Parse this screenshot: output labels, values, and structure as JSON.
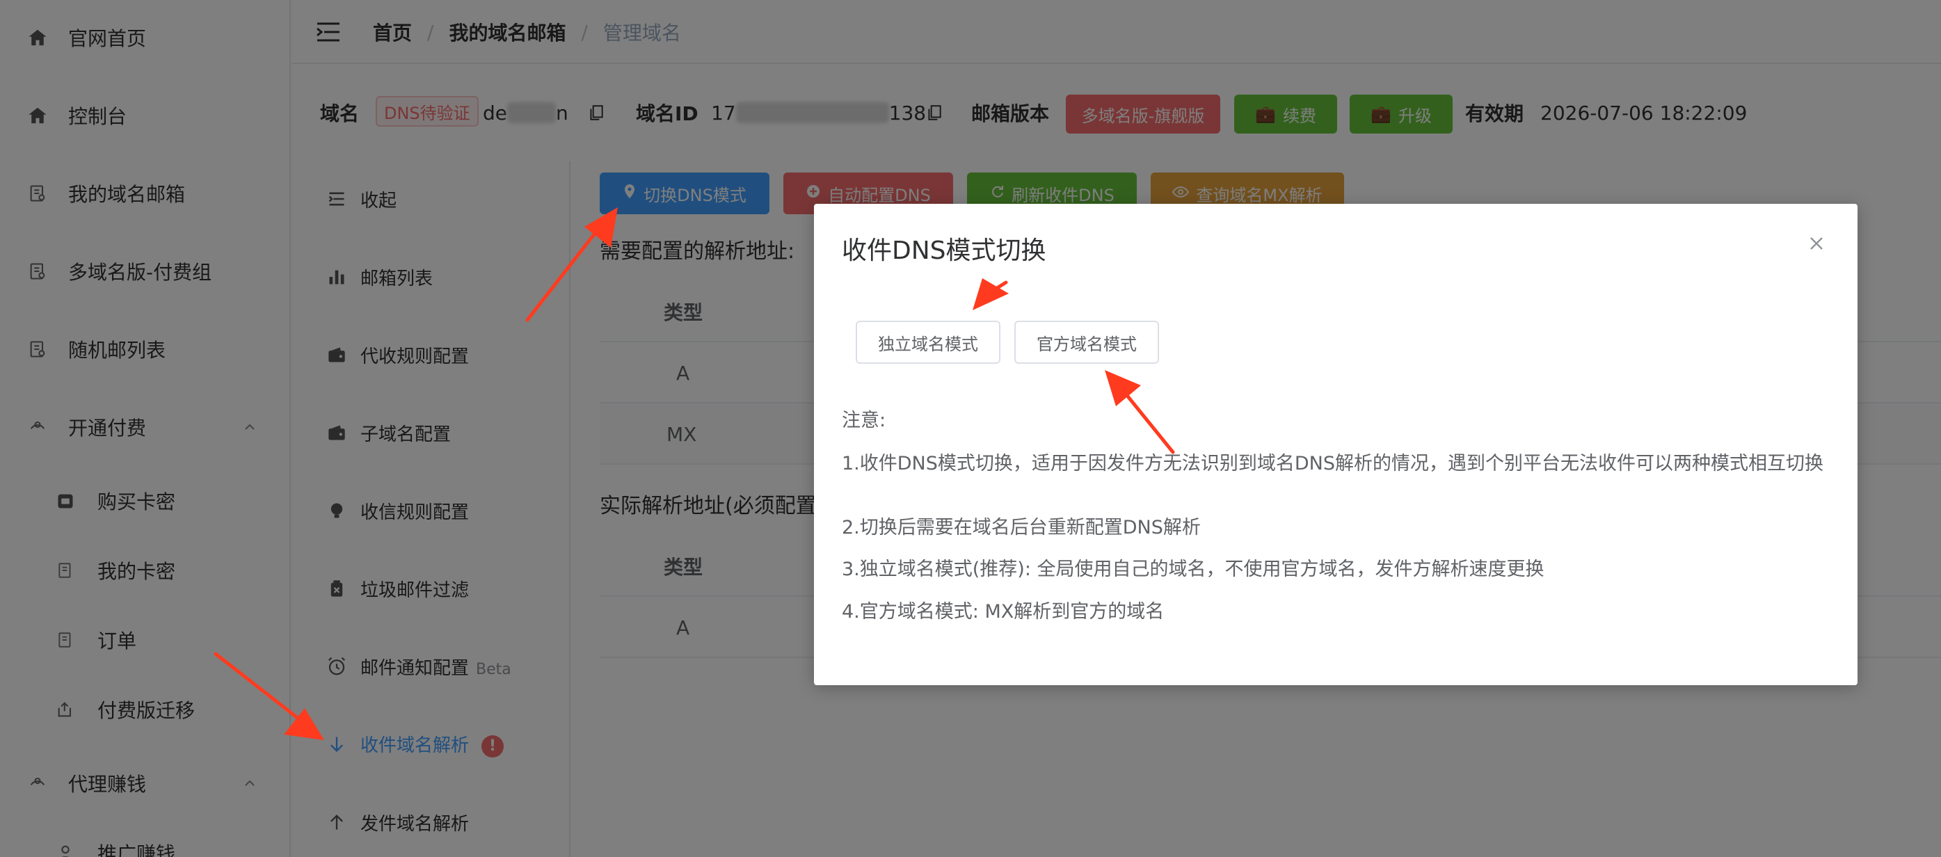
{
  "sidebar": {
    "items": [
      {
        "label": "官网首页",
        "icon": "home-icon"
      },
      {
        "label": "控制台",
        "icon": "home-icon"
      },
      {
        "label": "我的域名邮箱",
        "icon": "document-icon"
      },
      {
        "label": "多域名版-付费组",
        "icon": "document-icon"
      },
      {
        "label": "随机邮列表",
        "icon": "document-icon"
      },
      {
        "label": "开通付费",
        "icon": "gift-icon"
      },
      {
        "label": "购买卡密",
        "icon": "calendar-icon"
      },
      {
        "label": "我的卡密",
        "icon": "document-icon"
      },
      {
        "label": "订单",
        "icon": "document-icon"
      },
      {
        "label": "付费版迁移",
        "icon": "export-icon"
      },
      {
        "label": "代理赚钱",
        "icon": "gift-icon"
      },
      {
        "label": "推广赚钱",
        "icon": "user-icon"
      }
    ]
  },
  "header": {
    "breadcrumb": [
      "首页",
      "我的域名邮箱",
      "管理域名"
    ],
    "separator": "/"
  },
  "domain_info": {
    "domain_label": "域名",
    "dns_tag": "DNS待验证",
    "domain_prefix": "de",
    "domain_suffix": "n",
    "id_label": "域名ID",
    "id_prefix": "17",
    "id_suffix": "138",
    "version_label": "邮箱版本",
    "version_button": "多域名版-旗舰版",
    "renew_button": "续费",
    "upgrade_button": "升级",
    "expiry_label": "有效期",
    "expiry_value": "2026-07-06 18:22:09"
  },
  "submenu": {
    "items": [
      {
        "label": "收起",
        "icon": "collapse-icon"
      },
      {
        "label": "邮箱列表",
        "icon": "bar-chart-icon"
      },
      {
        "label": "代收规则配置",
        "icon": "wallet-icon"
      },
      {
        "label": "子域名配置",
        "icon": "wallet-icon"
      },
      {
        "label": "收信规则配置",
        "icon": "bulb-icon"
      },
      {
        "label": "垃圾邮件过滤",
        "icon": "trash-filter-icon"
      },
      {
        "label": "邮件通知配置",
        "icon": "alarm-clock-icon",
        "badge": "Beta"
      },
      {
        "label": "收件域名解析",
        "icon": "arrow-down-icon",
        "alert": "!"
      },
      {
        "label": "发件域名解析",
        "icon": "arrow-up-icon"
      }
    ],
    "active_index": 7
  },
  "content": {
    "buttons": [
      {
        "label": "切换DNS模式",
        "icon": "location-icon"
      },
      {
        "label": "自动配置DNS",
        "icon": "plus-circle-icon"
      },
      {
        "label": "刷新收件DNS",
        "icon": "refresh-icon"
      },
      {
        "label": "查询域名MX解析",
        "icon": "eye-icon"
      }
    ],
    "section1_title": "需要配置的解析地址:",
    "section2_title": "实际解析地址(必须配置",
    "table_header": "类型",
    "table1_rows": [
      "A",
      "MX"
    ],
    "table2_rows": [
      "A"
    ]
  },
  "modal": {
    "title": "收件DNS模式切换",
    "option1": "独立域名模式",
    "option2": "官方域名模式",
    "notes_title": "注意:",
    "notes": [
      "1.收件DNS模式切换，适用于因发件方无法识别到域名DNS解析的情况，遇到个别平台无法收件可以两种模式相互切换",
      "2.切换后需要在域名后台重新配置DNS解析",
      "3.独立域名模式(推荐): 全局使用自己的域名，不使用官方域名，发件方解析速度更换",
      "4.官方域名模式: MX解析到官方的域名"
    ]
  },
  "colors": {
    "primary": "#409eff",
    "danger": "#f56c6c",
    "success": "#67c23a",
    "warning": "#e6a23c",
    "annotation_arrow": "#ff3b1f"
  }
}
